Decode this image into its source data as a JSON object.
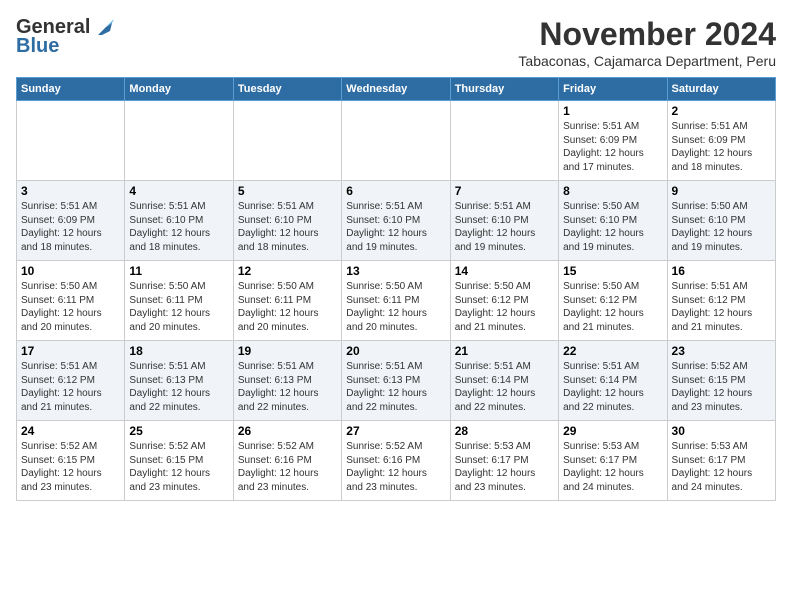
{
  "logo": {
    "general": "General",
    "blue": "Blue"
  },
  "title": {
    "month": "November 2024",
    "location": "Tabaconas, Cajamarca Department, Peru"
  },
  "headers": [
    "Sunday",
    "Monday",
    "Tuesday",
    "Wednesday",
    "Thursday",
    "Friday",
    "Saturday"
  ],
  "weeks": [
    {
      "shaded": false,
      "days": [
        {
          "num": "",
          "info": ""
        },
        {
          "num": "",
          "info": ""
        },
        {
          "num": "",
          "info": ""
        },
        {
          "num": "",
          "info": ""
        },
        {
          "num": "",
          "info": ""
        },
        {
          "num": "1",
          "info": "Sunrise: 5:51 AM\nSunset: 6:09 PM\nDaylight: 12 hours and 17 minutes."
        },
        {
          "num": "2",
          "info": "Sunrise: 5:51 AM\nSunset: 6:09 PM\nDaylight: 12 hours and 18 minutes."
        }
      ]
    },
    {
      "shaded": true,
      "days": [
        {
          "num": "3",
          "info": "Sunrise: 5:51 AM\nSunset: 6:09 PM\nDaylight: 12 hours and 18 minutes."
        },
        {
          "num": "4",
          "info": "Sunrise: 5:51 AM\nSunset: 6:10 PM\nDaylight: 12 hours and 18 minutes."
        },
        {
          "num": "5",
          "info": "Sunrise: 5:51 AM\nSunset: 6:10 PM\nDaylight: 12 hours and 18 minutes."
        },
        {
          "num": "6",
          "info": "Sunrise: 5:51 AM\nSunset: 6:10 PM\nDaylight: 12 hours and 19 minutes."
        },
        {
          "num": "7",
          "info": "Sunrise: 5:51 AM\nSunset: 6:10 PM\nDaylight: 12 hours and 19 minutes."
        },
        {
          "num": "8",
          "info": "Sunrise: 5:50 AM\nSunset: 6:10 PM\nDaylight: 12 hours and 19 minutes."
        },
        {
          "num": "9",
          "info": "Sunrise: 5:50 AM\nSunset: 6:10 PM\nDaylight: 12 hours and 19 minutes."
        }
      ]
    },
    {
      "shaded": false,
      "days": [
        {
          "num": "10",
          "info": "Sunrise: 5:50 AM\nSunset: 6:11 PM\nDaylight: 12 hours and 20 minutes."
        },
        {
          "num": "11",
          "info": "Sunrise: 5:50 AM\nSunset: 6:11 PM\nDaylight: 12 hours and 20 minutes."
        },
        {
          "num": "12",
          "info": "Sunrise: 5:50 AM\nSunset: 6:11 PM\nDaylight: 12 hours and 20 minutes."
        },
        {
          "num": "13",
          "info": "Sunrise: 5:50 AM\nSunset: 6:11 PM\nDaylight: 12 hours and 20 minutes."
        },
        {
          "num": "14",
          "info": "Sunrise: 5:50 AM\nSunset: 6:12 PM\nDaylight: 12 hours and 21 minutes."
        },
        {
          "num": "15",
          "info": "Sunrise: 5:50 AM\nSunset: 6:12 PM\nDaylight: 12 hours and 21 minutes."
        },
        {
          "num": "16",
          "info": "Sunrise: 5:51 AM\nSunset: 6:12 PM\nDaylight: 12 hours and 21 minutes."
        }
      ]
    },
    {
      "shaded": true,
      "days": [
        {
          "num": "17",
          "info": "Sunrise: 5:51 AM\nSunset: 6:12 PM\nDaylight: 12 hours and 21 minutes."
        },
        {
          "num": "18",
          "info": "Sunrise: 5:51 AM\nSunset: 6:13 PM\nDaylight: 12 hours and 22 minutes."
        },
        {
          "num": "19",
          "info": "Sunrise: 5:51 AM\nSunset: 6:13 PM\nDaylight: 12 hours and 22 minutes."
        },
        {
          "num": "20",
          "info": "Sunrise: 5:51 AM\nSunset: 6:13 PM\nDaylight: 12 hours and 22 minutes."
        },
        {
          "num": "21",
          "info": "Sunrise: 5:51 AM\nSunset: 6:14 PM\nDaylight: 12 hours and 22 minutes."
        },
        {
          "num": "22",
          "info": "Sunrise: 5:51 AM\nSunset: 6:14 PM\nDaylight: 12 hours and 22 minutes."
        },
        {
          "num": "23",
          "info": "Sunrise: 5:52 AM\nSunset: 6:15 PM\nDaylight: 12 hours and 23 minutes."
        }
      ]
    },
    {
      "shaded": false,
      "days": [
        {
          "num": "24",
          "info": "Sunrise: 5:52 AM\nSunset: 6:15 PM\nDaylight: 12 hours and 23 minutes."
        },
        {
          "num": "25",
          "info": "Sunrise: 5:52 AM\nSunset: 6:15 PM\nDaylight: 12 hours and 23 minutes."
        },
        {
          "num": "26",
          "info": "Sunrise: 5:52 AM\nSunset: 6:16 PM\nDaylight: 12 hours and 23 minutes."
        },
        {
          "num": "27",
          "info": "Sunrise: 5:52 AM\nSunset: 6:16 PM\nDaylight: 12 hours and 23 minutes."
        },
        {
          "num": "28",
          "info": "Sunrise: 5:53 AM\nSunset: 6:17 PM\nDaylight: 12 hours and 23 minutes."
        },
        {
          "num": "29",
          "info": "Sunrise: 5:53 AM\nSunset: 6:17 PM\nDaylight: 12 hours and 24 minutes."
        },
        {
          "num": "30",
          "info": "Sunrise: 5:53 AM\nSunset: 6:17 PM\nDaylight: 12 hours and 24 minutes."
        }
      ]
    }
  ]
}
